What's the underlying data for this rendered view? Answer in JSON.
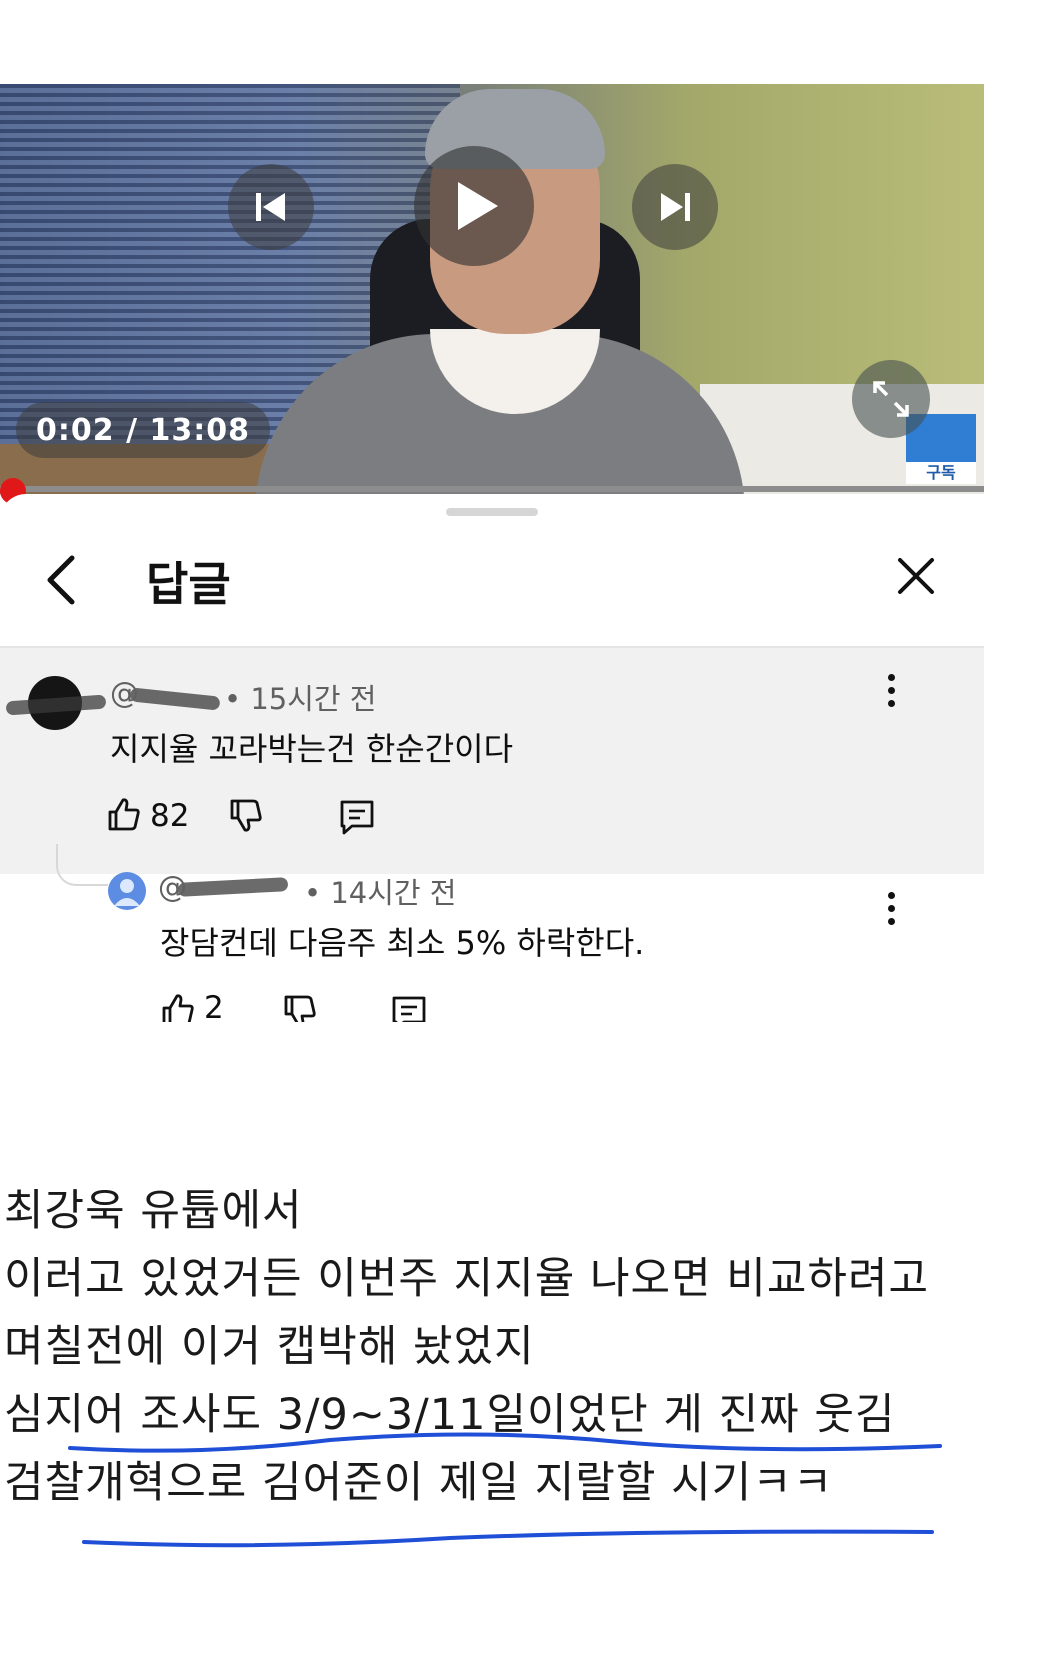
{
  "video": {
    "time": "0:02 / 13:08",
    "progress_fraction": 0.0015,
    "subscribe_badge_label": "구독",
    "icons": {
      "prev": "previous-icon",
      "play": "play-icon",
      "next": "next-icon",
      "fullscreen": "fullscreen-icon"
    }
  },
  "header": {
    "title": "답글",
    "back_icon": "chevron-left-icon",
    "close_icon": "close-icon"
  },
  "comments": [
    {
      "handle_prefix": "@",
      "time": "• 15시간 전",
      "text": "지지율 꼬라박는건 한순간이다",
      "likes": "82"
    },
    {
      "handle_prefix": "@",
      "time": "• 14시간 전",
      "text": "장담컨데 다음주 최소 5% 하락한다.",
      "likes": "2"
    }
  ],
  "note_lines": [
    "최강욱 유튭에서",
    "이러고 있었거든 이번주 지지율 나오면 비교하려고",
    "며칠전에 이거 캡박해 놨었지",
    "심지어 조사도 3/9~3/11일이었단 게 진짜 웃김",
    "검찰개혁으로 김어준이 제일 지랄할 시기ㅋㅋ"
  ],
  "colors": {
    "progress": "#e01818",
    "underline": "#1f4fd6",
    "comment_bg": "#f1f1f1"
  }
}
